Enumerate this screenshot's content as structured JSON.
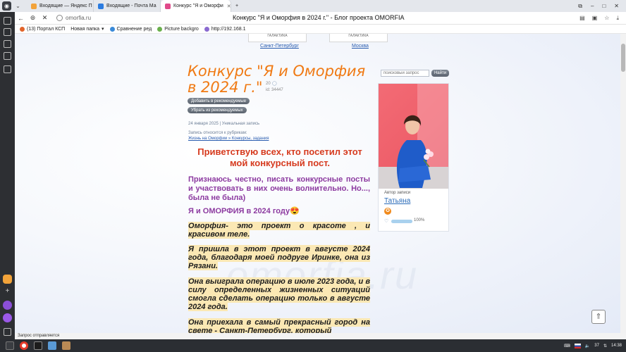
{
  "browser": {
    "tabs": [
      {
        "label": "Входящие — Яндекс П",
        "fav_color": "#f2a33a"
      },
      {
        "label": "Входящие - Почта Ма",
        "fav_color": "#2a7be0"
      },
      {
        "label": "Конкурс \"Я и Оморфи",
        "fav_color": "#e04a8a",
        "active": true
      }
    ],
    "url": "omorfia.ru",
    "page_title": "Конкурс \"Я и Оморфия в 2024 г.\" - Блог проекта OMORFIA",
    "bookmarks": [
      {
        "label": "(13) Портал КСП",
        "color": "#e2642a"
      },
      {
        "label": "Новая папка",
        "color": "#999999"
      },
      {
        "label": "Сравнение ред",
        "color": "#3a8ad8"
      },
      {
        "label": "Picture backgro",
        "color": "#6ab04c"
      },
      {
        "label": "http://192.168.1",
        "color": "#8a6ad0"
      }
    ]
  },
  "page": {
    "cities": [
      {
        "card": "ГАЛАКТИКА",
        "link": "Санкт-Петербург"
      },
      {
        "card": "ГАЛАКТИКА",
        "link": "Москва"
      }
    ],
    "headline": "Конкурс \"Я и Оморфия в 2024 г.\"",
    "comments_count": "20",
    "views": "34447",
    "add_recommended": "Добавить в рекомендуемые",
    "remove_recommended": "Убрать из рекомендуемых",
    "date_line": "24 января 2025 | Уникальная запись",
    "rubric_label": "Запись относится к рубрикам:",
    "rubric_links": "Жизнь на Оморфии » Конкурсы, задания",
    "greeting": "Приветствую всех, кто посетил этот мой конкурсный пост.",
    "intro": "Признаюсь честно, писать конкурсные посты и участвовать в них очень волнительно. Но..., была не была)",
    "subtitle": "Я и ОМОРФИЯ в 2024 году😍",
    "para1": "Оморфия- это проект о красоте , и красивом теле.",
    "para2": "Я пришла в этот проект в августе 2024 года, благодаря моей подруге Иринке, она из Рязани.",
    "para3": "Она выиграла операцию в июле 2023 года, и в силу определенных жизненных ситуаций смогла сделать операцию только в августе 2024 года.",
    "para4": "Она приехала в самый прекрасный город на свете - Санкт-Петербург, который",
    "watermark": "omorfia.ru"
  },
  "sidebar_right": {
    "search_placeholder": "поисковый запрос",
    "search_button": "Найти",
    "author_caption": "Автор записи",
    "author_name": "Татьяна",
    "rating_percent": "100%",
    "rating_fraction": 1.0
  },
  "status_text": "Запрос отправляется",
  "tray": {
    "time": "14:38",
    "battery": "37"
  }
}
